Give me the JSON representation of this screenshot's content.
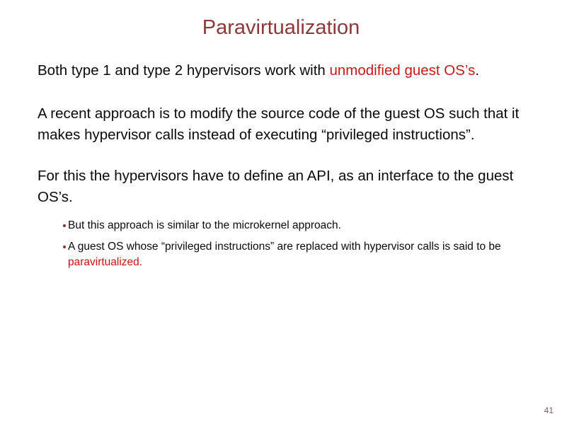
{
  "slide": {
    "title": "Paravirtualization",
    "page_number": "41",
    "colors": {
      "title": "#8c3a38",
      "accent_red": "#c51a1a",
      "bullet_red": "#cc1111",
      "bullet_dot": "#8f2f2e",
      "body_text": "#0a0a0a",
      "page_number": "#7a5c5c",
      "background": "#ffffff"
    },
    "paragraphs": [
      {
        "id": "p1",
        "segments": [
          {
            "text": "Both type 1 and type 2 hypervisors work with ",
            "style": "normal"
          },
          {
            "text": "unmodified guest OS’s",
            "style": "red"
          },
          {
            "text": ".",
            "style": "normal"
          }
        ]
      },
      {
        "id": "p2",
        "segments": [
          {
            "text": "A recent approach is to modify the source code of the guest OS such that it makes hypervisor calls instead of executing “privileged instructions”.",
            "style": "normal"
          }
        ]
      },
      {
        "id": "p3",
        "segments": [
          {
            "text": "For this the hypervisors have to define an API, as an interface to the guest OS’s.",
            "style": "normal"
          }
        ]
      }
    ],
    "bullets": [
      {
        "id": "b1",
        "marker": "bullet-dot",
        "segments": [
          {
            "text": "But this approach is similar to the microkernel approach.",
            "style": "normal"
          }
        ]
      },
      {
        "id": "b2",
        "marker": "bullet-dot",
        "segments": [
          {
            "text": "A guest OS whose “privileged instructions” are replaced with hypervisor calls is said to be ",
            "style": "normal"
          },
          {
            "text": "paravirtualized.",
            "style": "red"
          }
        ]
      }
    ]
  }
}
